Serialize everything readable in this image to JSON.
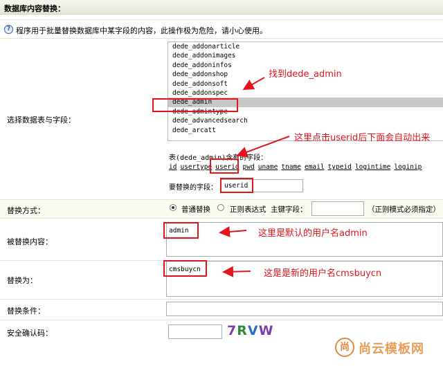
{
  "header": {
    "title": "数据库内容替换："
  },
  "help": {
    "text": "程序用于批量替换数据库中某字段的内容，此操作极为危险，请小心使用。"
  },
  "labels": {
    "table_field": "选择数据表与字段：",
    "mode": "替换方式：",
    "target": "被替换内容：",
    "replace": "替换为：",
    "condition": "替换条件：",
    "captcha": "安全确认码："
  },
  "tables": [
    "dede_addonarticle",
    "dede_addonimages",
    "dede_addoninfos",
    "dede_addonshop",
    "dede_addonsoft",
    "dede_addonspec",
    "dede_admin",
    "dede_admintype",
    "dede_advancedsearch",
    "dede_arcatt"
  ],
  "fields_panel": {
    "title": "表(dede_admin)含有的字段：",
    "fields": [
      "id",
      "usertype",
      "userid",
      "pwd",
      "uname",
      "tname",
      "email",
      "typeid",
      "logintime",
      "loginip"
    ]
  },
  "field_input": {
    "label": "要替换的字段：",
    "value": "userid"
  },
  "mode": {
    "normal": "普通替换",
    "regex": "正则表达式",
    "key_label": "主键字段：",
    "hint": "（正则模式必须指定）"
  },
  "target_value": "admin",
  "replace_value": "cmsbuycn",
  "captcha_text": "7RVW",
  "captcha_colors": [
    "#7a3db3",
    "#2f8a3b",
    "#2b6fc0",
    "#7a3db3"
  ],
  "annotations": {
    "find_admin": "找到dede_admin",
    "click_userid": "这里点击userid后下面会自动出来",
    "default_user": "这里是默认的用户名admin",
    "new_user": "这是是新的用户名cmsbuycn"
  },
  "watermark": {
    "logo": "尚",
    "text": "尚云模板网"
  },
  "colors": {
    "annotation_red": "#e3141b",
    "watermark_orange": "#e38b3a"
  }
}
